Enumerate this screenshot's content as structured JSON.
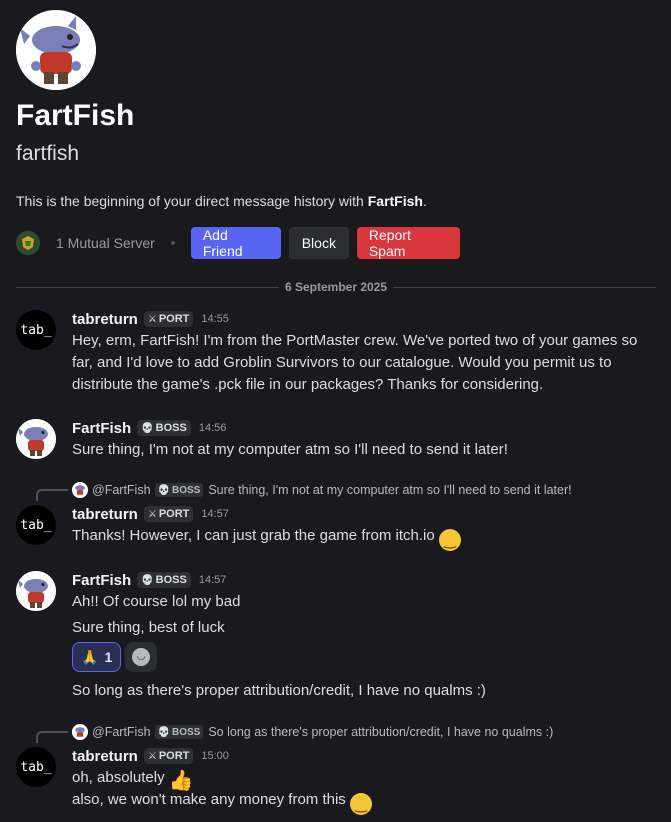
{
  "profile": {
    "display_name": "FartFish",
    "username": "fartfish",
    "intro_prefix": "This is the beginning of your direct message history with ",
    "intro_name": "FartFish",
    "intro_suffix": ".",
    "mutual_servers": "1 Mutual Server",
    "add_friend": "Add Friend",
    "block": "Block",
    "report_spam": "Report Spam"
  },
  "divider_date": "6 September 2025",
  "messages": [
    {
      "author": "tabreturn",
      "tag_icon": "sword-icon",
      "tag": "PORT",
      "time": "14:55",
      "lines": [
        "Hey, erm, FartFish! I'm from the PortMaster crew. We've ported two of your games so far, and I'd love to add Groblin Survivors to our catalogue. Would you permit us to distribute the game's .pck file in our packages? Thanks for considering."
      ]
    },
    {
      "author": "FartFish",
      "tag_icon": "skull-icon",
      "tag": "BOSS",
      "time": "14:56",
      "lines": [
        "Sure thing, I'm not at my computer atm so I'll need to send it later!"
      ]
    },
    {
      "reply_name": "@FartFish",
      "reply_tag": "BOSS",
      "reply_text": "Sure thing, I'm not at my computer atm so I'll need to send it later!",
      "author": "tabreturn",
      "tag": "PORT",
      "time": "14:57",
      "lines": [
        "Thanks! However, I can just grab the game from itch.io"
      ]
    },
    {
      "author": "FartFish",
      "tag": "BOSS",
      "time": "14:57",
      "lines": [
        "Ah!! Of course lol my bad",
        "Sure thing, best of luck",
        "So long as there's proper attribution/credit, I have no qualms :)"
      ],
      "reaction_emoji": "🙏",
      "reaction_count": "1"
    },
    {
      "reply_name": "@FartFish",
      "reply_tag": "BOSS",
      "reply_text": "So long as there's proper attribution/credit, I have no qualms :)",
      "author": "tabreturn",
      "tag": "PORT",
      "time": "15:00",
      "lines": [
        "oh, absolutely",
        "also, we won't make any money from this"
      ]
    }
  ],
  "tab_avatar_text": "tab_",
  "colors": {
    "background": "#1a1a1e",
    "blurple": "#5865f2",
    "danger": "#da373c",
    "emoji_yellow": "#f6c635"
  }
}
